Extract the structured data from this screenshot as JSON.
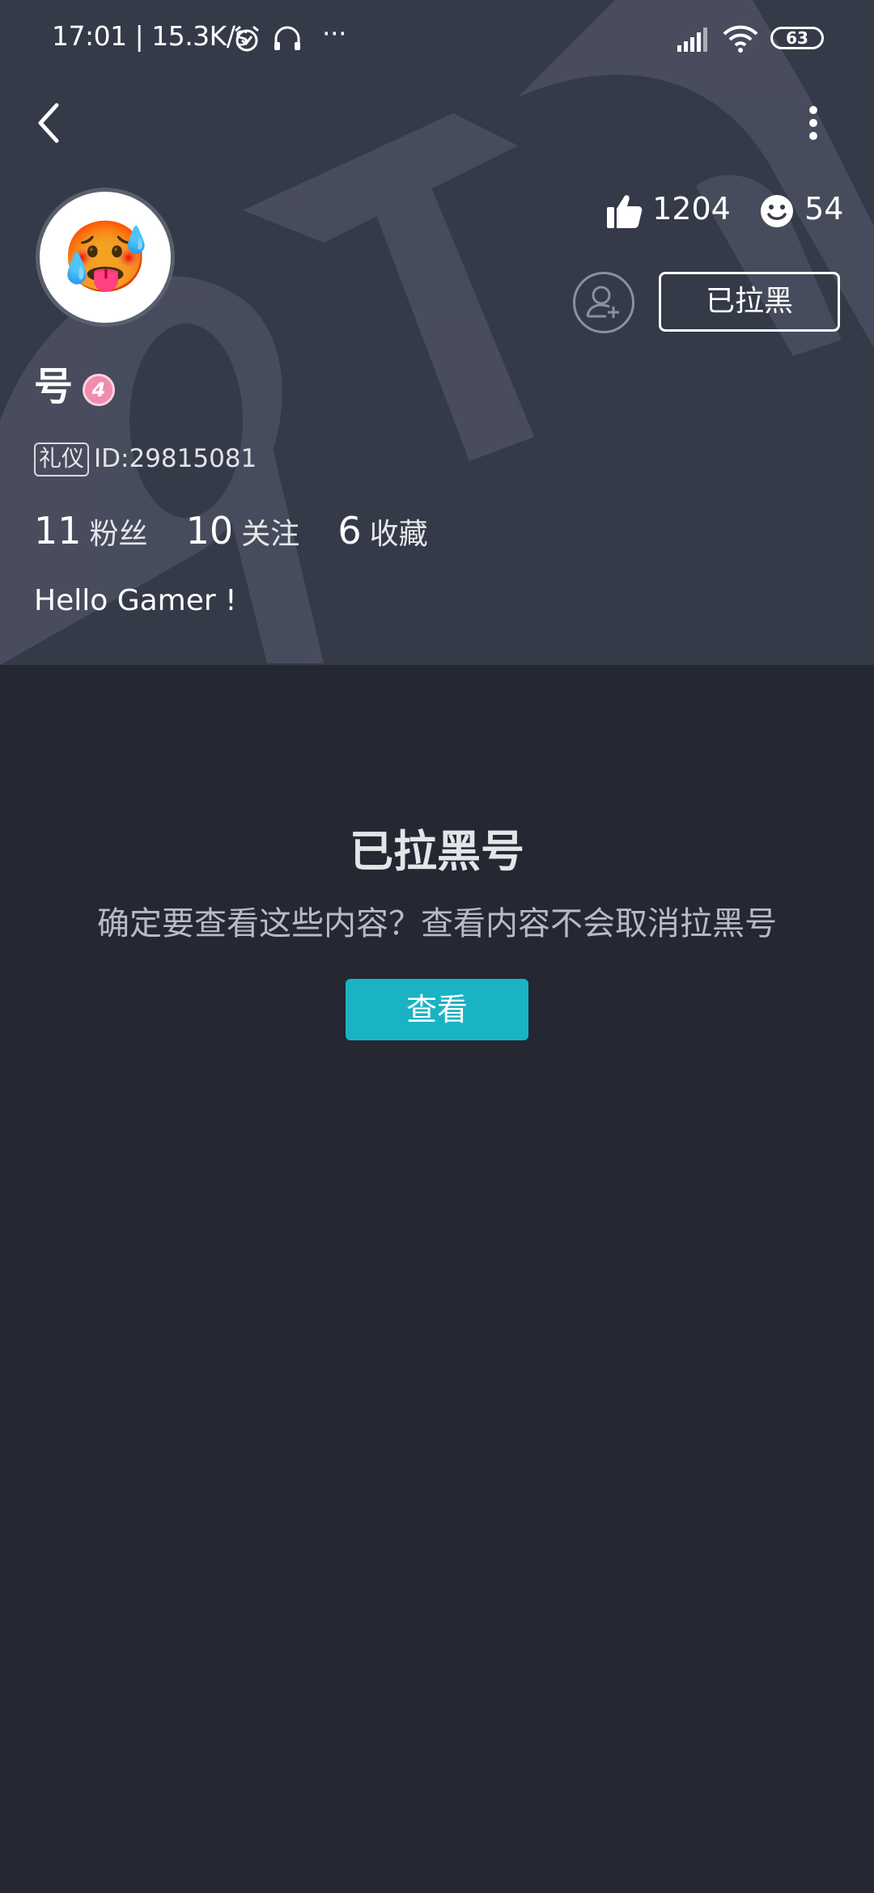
{
  "status_bar": {
    "time_and_speed": "17:01 | 15.3K/s",
    "more": "···",
    "battery": "63"
  },
  "profile": {
    "avatar_emoji": "🥵",
    "username": "号",
    "level": "4",
    "tag": "礼仪",
    "user_id": "ID:29815081",
    "bio": "Hello Gamer !",
    "likes": "1204",
    "smiles": "54",
    "blacklist_button": "已拉黑",
    "counts": [
      {
        "num": "11",
        "label": "粉丝"
      },
      {
        "num": "10",
        "label": "关注"
      },
      {
        "num": "6",
        "label": "收藏"
      }
    ]
  },
  "blocked": {
    "title": "已拉黑号",
    "message": "确定要查看这些内容？查看内容不会取消拉黑号",
    "view_button": "查看"
  },
  "colors": {
    "header_bg": "#353a49",
    "page_bg": "#252733",
    "accent": "#1ab3c4",
    "level_badge": "#f08cb0"
  },
  "icons": {
    "back": "chevron-left-icon",
    "more": "more-vertical-icon",
    "like": "thumbs-up-icon",
    "smile": "smile-icon",
    "add_friend": "add-friend-icon",
    "alarm": "alarm-clock-icon",
    "headset": "headset-icon",
    "signal": "signal-icon",
    "wifi": "wifi-icon"
  }
}
